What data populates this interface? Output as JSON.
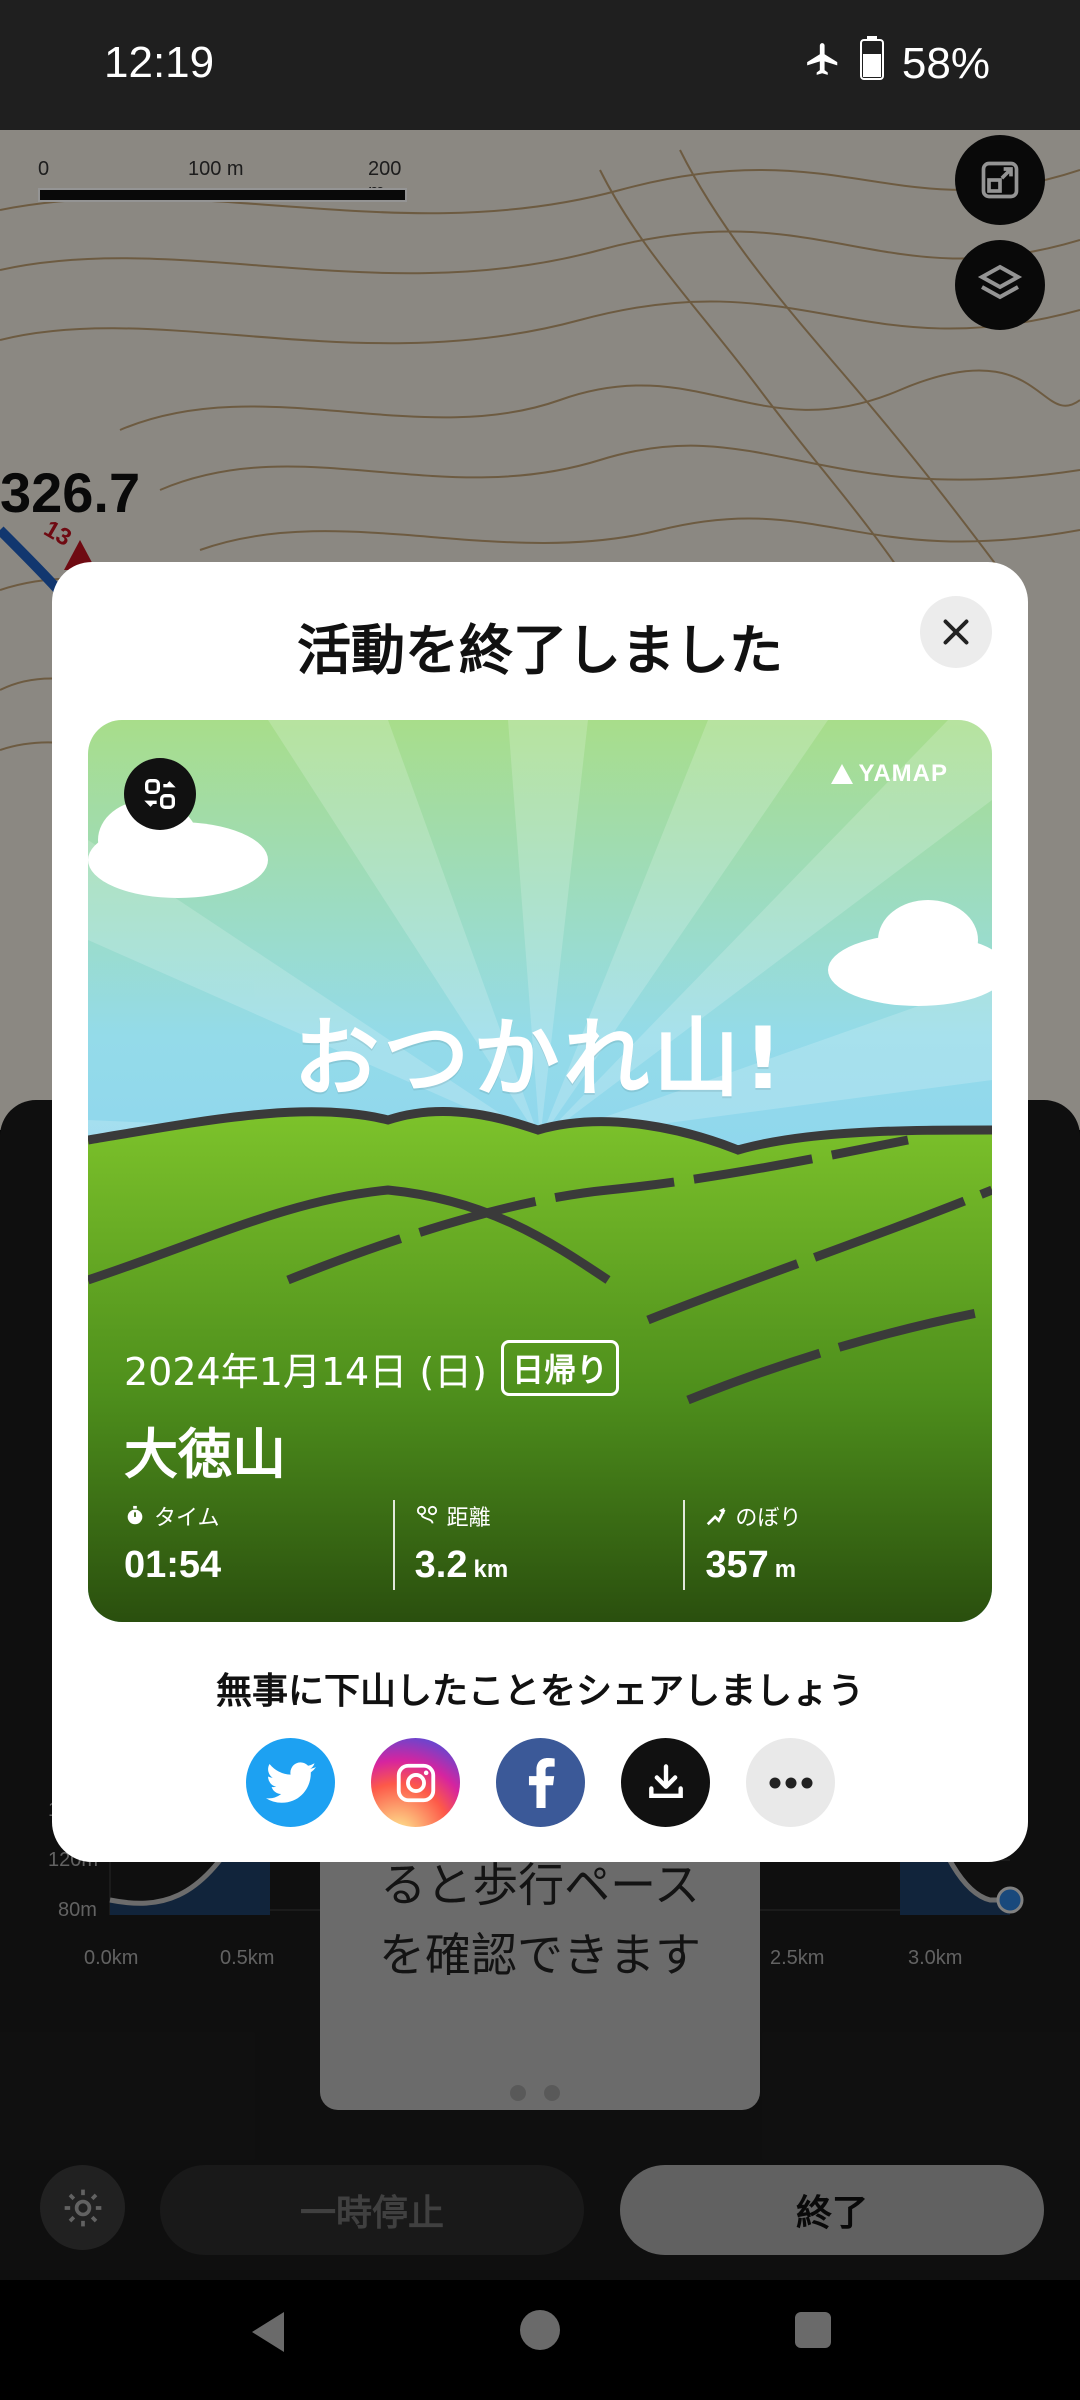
{
  "status_bar": {
    "time": "12:19",
    "battery": "58%",
    "icons": [
      "airplane-icon",
      "battery-icon"
    ]
  },
  "map": {
    "scale_labels": [
      "0",
      "100 m",
      "200 m"
    ],
    "elevation_label": "326.7",
    "route_marker": "13"
  },
  "dialog": {
    "title": "活動を終了しました",
    "card": {
      "brand": "YAMAP",
      "headline": "おつかれ山!",
      "date": "2024年1月14日 (日)",
      "trip_type": "日帰り",
      "mountain": "大徳山",
      "stats": [
        {
          "label": "タイム",
          "value": "01:54",
          "unit": ""
        },
        {
          "label": "距離",
          "value": "3.2",
          "unit": "km"
        },
        {
          "label": "のぼり",
          "value": "357",
          "unit": "m"
        }
      ]
    },
    "share_prompt": "無事に下山したことをシェアしましょう",
    "share_buttons": [
      "twitter-icon",
      "instagram-icon",
      "facebook-icon",
      "download-icon",
      "more-icon"
    ]
  },
  "chart": {
    "y_ticks": [
      "160m",
      "120m",
      "80m"
    ],
    "x_ticks": [
      "0.0km",
      "0.5km",
      "2.5km",
      "3.0km"
    ]
  },
  "tooltip_lines": [
    "ると歩行ペース",
    "を確認できます"
  ],
  "controls": {
    "pause_label": "一時停止",
    "end_label": "終了"
  },
  "colors": {
    "accent_green": "#6fb22b",
    "sky": "#8fd6ee",
    "twitter": "#1da1f2",
    "facebook": "#3b5998"
  }
}
